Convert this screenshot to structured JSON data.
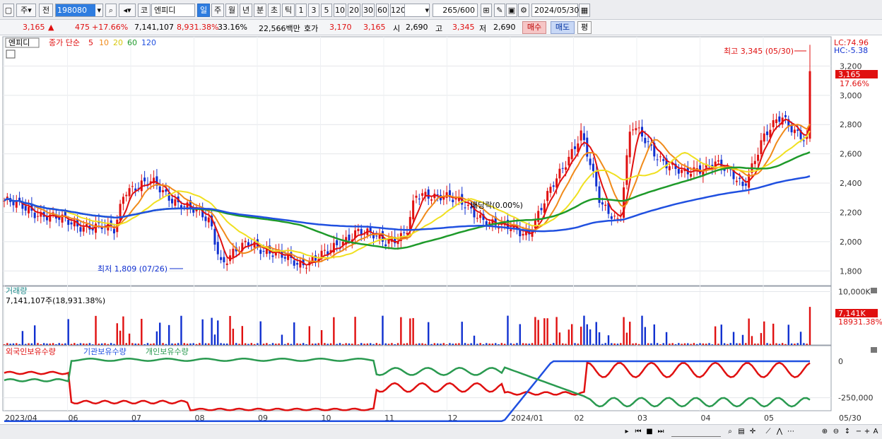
{
  "toolbar": {
    "period_main": "주",
    "period_prev": "전",
    "stock_code": "198080",
    "market": "코",
    "stock_name": "엔피디",
    "periods": [
      "일",
      "주",
      "월",
      "년",
      "분",
      "초",
      "틱"
    ],
    "minutes": [
      "1",
      "3",
      "5",
      "10",
      "20",
      "30",
      "60",
      "120"
    ],
    "count": "265",
    "count_total": "/600",
    "date": "2024/05/30"
  },
  "quote": {
    "price": "3,165",
    "change_arrow": "▲",
    "change": "475",
    "change_pct": "+17.66%",
    "volume": "7,141,107",
    "volume_ratio": "8,931.38%",
    "turnover_ratio": "33.16%",
    "amount": "22,566백만",
    "hoga_label": "호가",
    "ask": "3,170",
    "bid": "3,165",
    "open_label": "시",
    "open": "2,690",
    "high_label": "고",
    "high": "3,345",
    "low_label": "저",
    "low": "2,690",
    "buy_label": "매수",
    "sell_label": "매도",
    "avg_label": "평"
  },
  "price_panel": {
    "name_label": "엔피디",
    "ma_title": "종가 단순",
    "ma_periods": [
      "5",
      "10",
      "20",
      "60",
      "120"
    ],
    "lc": "LC:74.96",
    "hc": "HC:-5.38",
    "current_tag": "3,165",
    "current_pct": "17.66%",
    "high_annotation": "최고 3,345 (05/30)",
    "low_annotation": "최저 1,809 (07/26)",
    "dividend_annotation": "배당락(0.00%)"
  },
  "volume_panel": {
    "title": "거래량",
    "value_label": "7,141,107주(18,931.38%)",
    "current_tag": "7,141K",
    "current_pct": "18931.38%"
  },
  "holdings_panel": {
    "foreign": "외국인보유수량",
    "institution": "기관보유수량",
    "individual": "개인보유수량"
  },
  "colors": {
    "ma5": "#e01010",
    "ma10": "#f08a1a",
    "ma20": "#f0e020",
    "ma60": "#1e9a2a",
    "ma120": "#2050e0",
    "up": "#e01010",
    "down": "#1030d0"
  },
  "chart_data": [
    {
      "type": "candlestick",
      "title": "엔피디",
      "ylim": [
        1700,
        3400
      ],
      "y_ticks": [
        1800,
        2000,
        2200,
        2400,
        2600,
        2800,
        3000,
        3200
      ],
      "x_labels": [
        "2023/04",
        "06",
        "07",
        "08",
        "09",
        "10",
        "11",
        "12",
        "2024/01",
        "02",
        "03",
        "04",
        "05",
        "05/30"
      ],
      "close_path": [
        [
          "2023/04/03",
          2280
        ],
        [
          "2023/04/20",
          2200
        ],
        [
          "2023/05/10",
          2120
        ],
        [
          "2023/05/31",
          2080
        ],
        [
          "2023/06/05",
          2360
        ],
        [
          "2023/06/20",
          2400
        ],
        [
          "2023/07/05",
          2250
        ],
        [
          "2023/07/20",
          2150
        ],
        [
          "2023/07/26",
          1850
        ],
        [
          "2023/08/10",
          2000
        ],
        [
          "2023/08/25",
          1900
        ],
        [
          "2023/09/05",
          1850
        ],
        [
          "2023/09/20",
          1920
        ],
        [
          "2023/10/05",
          2080
        ],
        [
          "2023/10/20",
          2000
        ],
        [
          "2023/10/31",
          2060
        ],
        [
          "2023/11/05",
          2300
        ],
        [
          "2023/11/20",
          2330
        ],
        [
          "2023/12/05",
          2200
        ],
        [
          "2023/12/20",
          2100
        ],
        [
          "2024/01/03",
          2060
        ],
        [
          "2024/01/15",
          2350
        ],
        [
          "2024/01/31",
          2750
        ],
        [
          "2024/02/10",
          2250
        ],
        [
          "2024/02/20",
          2150
        ],
        [
          "2024/02/26",
          2800
        ],
        [
          "2024/03/10",
          2600
        ],
        [
          "2024/03/25",
          2450
        ],
        [
          "2024/04/10",
          2550
        ],
        [
          "2024/04/25",
          2380
        ],
        [
          "2024/05/05",
          2700
        ],
        [
          "2024/05/15",
          2850
        ],
        [
          "2024/05/29",
          2690
        ],
        [
          "2024/05/30",
          3165
        ]
      ],
      "annotations": [
        {
          "text": "최고 3,345 (05/30)",
          "x": "2024/05/30",
          "y": 3345
        },
        {
          "text": "최저 1,809 (07/26)",
          "x": "2023/07/26",
          "y": 1809
        }
      ]
    },
    {
      "type": "bar",
      "title": "거래량",
      "y_ticks": [
        "10,000K"
      ],
      "ylim": [
        0,
        11000000
      ],
      "last_value": 7141107
    },
    {
      "type": "line",
      "title": "외국인보유수량 / 기관보유수량 / 개인보유수량",
      "y_ticks": [
        "0",
        "-250,000"
      ],
      "series": [
        {
          "name": "외국인보유수량",
          "color": "#e01010"
        },
        {
          "name": "기관보유수량",
          "color": "#2050e0"
        },
        {
          "name": "개인보유수량",
          "color": "#2a9a50"
        }
      ]
    }
  ]
}
